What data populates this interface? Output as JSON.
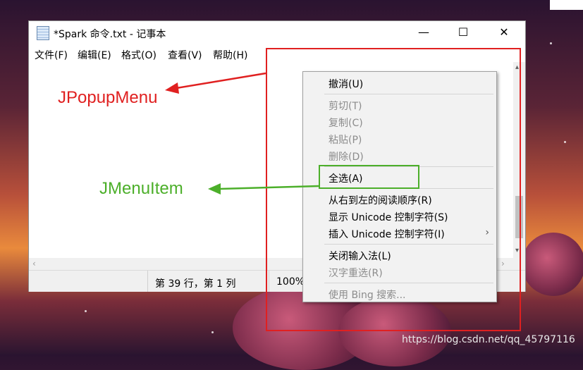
{
  "window": {
    "title": "*Spark 命令.txt - 记事本",
    "buttons": {
      "minimize": "—",
      "maximize": "☐",
      "close": "✕"
    }
  },
  "menubar": {
    "items": [
      "文件(F)",
      "编辑(E)",
      "格式(O)",
      "查看(V)",
      "帮助(H)"
    ]
  },
  "statusbar": {
    "position": "第 39 行，第 1 列",
    "zoom": "100%"
  },
  "context_menu": {
    "items": [
      {
        "label": "撤消(U)",
        "enabled": true
      },
      {
        "label": "剪切(T)",
        "enabled": false
      },
      {
        "label": "复制(C)",
        "enabled": false
      },
      {
        "label": "粘贴(P)",
        "enabled": false
      },
      {
        "label": "删除(D)",
        "enabled": false
      },
      {
        "label": "全选(A)",
        "enabled": true
      },
      {
        "label": "从右到左的阅读顺序(R)",
        "enabled": true
      },
      {
        "label": "显示 Unicode 控制字符(S)",
        "enabled": true
      },
      {
        "label": "插入 Unicode 控制字符(I)",
        "enabled": true,
        "submenu_arrow": "›"
      },
      {
        "label": "关闭输入法(L)",
        "enabled": true
      },
      {
        "label": "汉字重选(R)",
        "enabled": false
      },
      {
        "label": "使用 Bing 搜索...",
        "enabled": false
      }
    ]
  },
  "annotations": {
    "popup_label": "JPopupMenu",
    "item_label": "JMenuItem",
    "popup_color": "#e02020",
    "item_color": "#4caf2a"
  },
  "watermark": "https://blog.csdn.net/qq_45797116",
  "icons": {
    "app": "notepad-icon",
    "scroll_up": "▴",
    "scroll_down": "▾",
    "scroll_left": "‹",
    "scroll_right": "›"
  }
}
